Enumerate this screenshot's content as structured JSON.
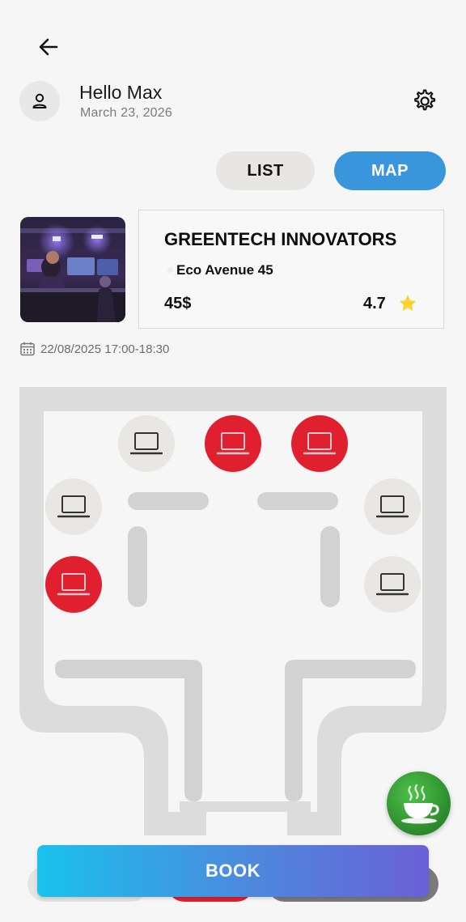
{
  "header": {
    "greeting": "Hello Max",
    "date": "March 23, 2026"
  },
  "view_toggle": {
    "list_label": "LIST",
    "map_label": "MAP",
    "active": "MAP"
  },
  "venue": {
    "name": "GREENTECH INNOVATORS",
    "address": "Eco Avenue 45",
    "price": "45$",
    "rating": "4.7"
  },
  "booking": {
    "datetime": "22/08/2025 17:00-18:30"
  },
  "floor_plan": {
    "seats": [
      {
        "id": "seat-1",
        "status": "free"
      },
      {
        "id": "seat-2",
        "status": "taken"
      },
      {
        "id": "seat-3",
        "status": "taken"
      },
      {
        "id": "seat-4",
        "status": "free"
      },
      {
        "id": "seat-5",
        "status": "free"
      },
      {
        "id": "seat-6",
        "status": "taken"
      },
      {
        "id": "seat-7",
        "status": "free"
      }
    ]
  },
  "actions": {
    "book_label": "BOOK"
  },
  "colors": {
    "accent_blue": "#3a96dc",
    "taken_red": "#e0202f",
    "free_grey": "#e8e7e3",
    "wall_grey": "#dcdcdc",
    "coffee_green": "#2b8a2c"
  },
  "icons": [
    "back-arrow-icon",
    "user-icon",
    "gear-icon",
    "star-icon",
    "calendar-icon",
    "laptop-icon",
    "coffee-cup-icon"
  ]
}
